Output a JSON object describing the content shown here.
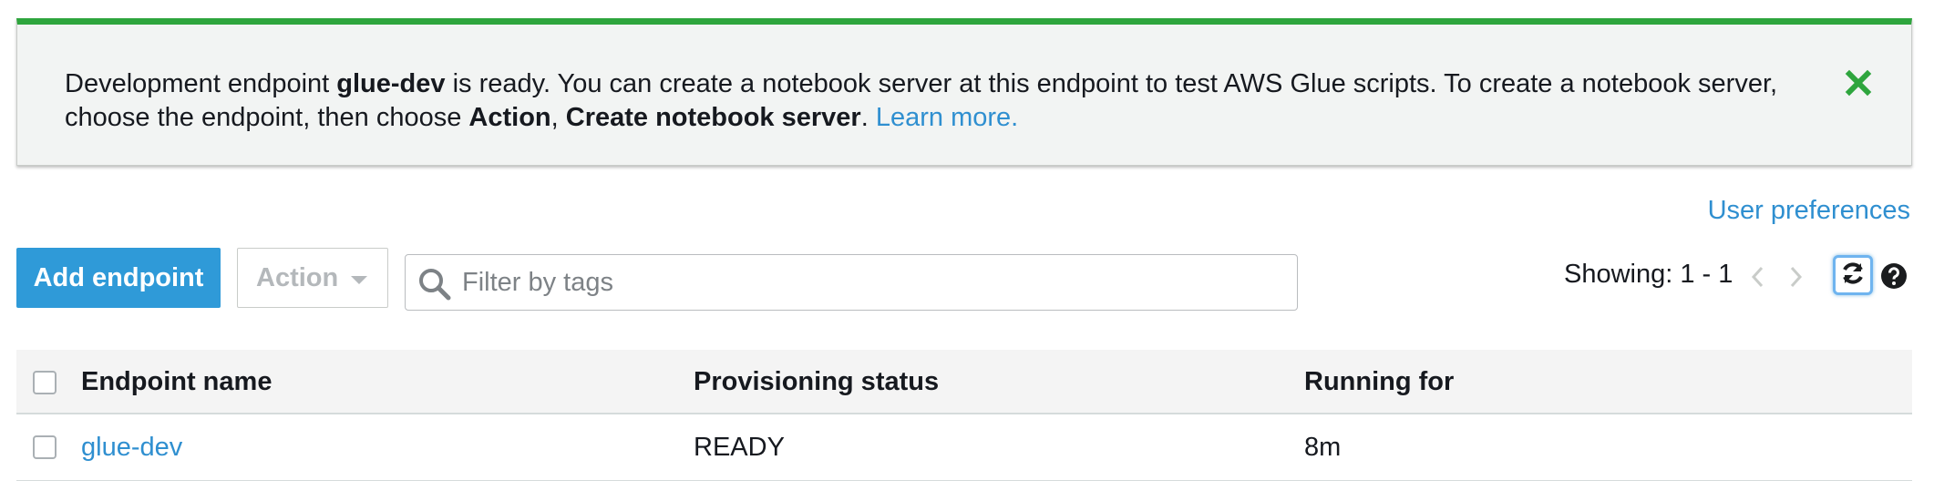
{
  "flash": {
    "text_before": "Development endpoint ",
    "endpoint_name": "glue-dev",
    "text_middle": " is ready. You can create a notebook server at this endpoint to test AWS Glue scripts. To create a notebook server, choose the endpoint, then choose ",
    "action_word": "Action",
    "comma": ", ",
    "create_word": "Create notebook server",
    "period": ". ",
    "learn_more": "Learn more.",
    "accent_color": "#2ea53d",
    "close_icon": "close-icon"
  },
  "header": {
    "user_preferences": "User preferences"
  },
  "toolbar": {
    "add_label": "Add endpoint",
    "action_label": "Action",
    "filter_placeholder": "Filter by tags",
    "showing_text": "Showing: 1 - 1"
  },
  "table": {
    "columns": [
      "Endpoint name",
      "Provisioning status",
      "Running for"
    ],
    "rows": [
      {
        "name": "glue-dev",
        "status": "READY",
        "running_for": "8m"
      }
    ]
  },
  "colors": {
    "primary": "#2f9ad8",
    "link": "#2f8fd0",
    "success": "#2ea53d"
  }
}
